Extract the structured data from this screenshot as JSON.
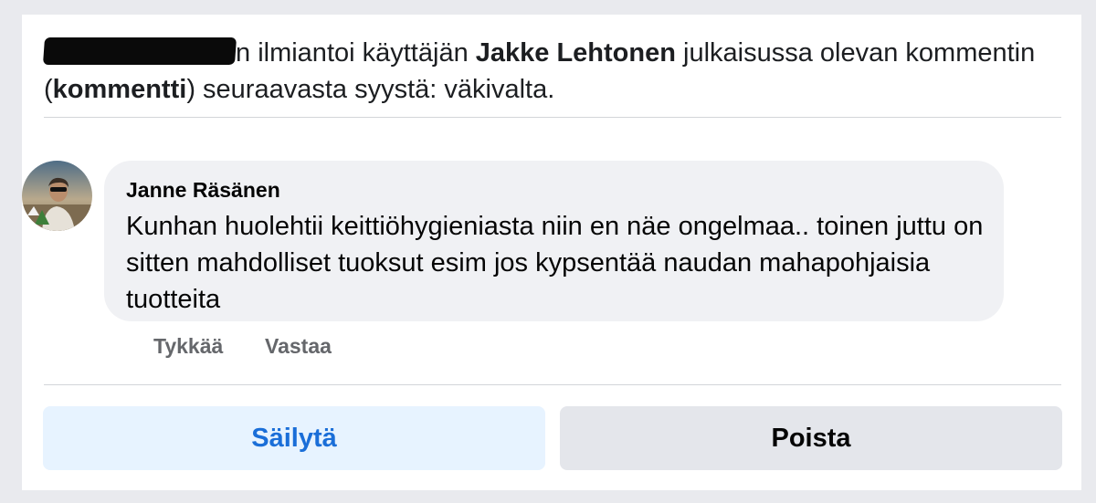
{
  "report": {
    "reporter_visible_suffix": "n",
    "text_1": " ilmiantoi käyttäjän ",
    "reported_user": "Jakke Lehtonen",
    "text_2": " julkaisussa olevan kommentin (",
    "item_type": "kommentti",
    "text_3": ") seuraavasta syystä: väkivalta."
  },
  "comment": {
    "author": "Janne Räsänen",
    "body": "Kunhan huolehtii keittiöhygieniasta niin en näe ongelmaa.. toinen juttu on sitten mahdolliset tuoksut esim jos kypsentää naudan mahapohjaisia tuotteita",
    "actions": {
      "like": "Tykkää",
      "reply": "Vastaa"
    }
  },
  "buttons": {
    "keep": "Säilytä",
    "remove": "Poista"
  },
  "colors": {
    "keep_bg": "#e7f3ff",
    "keep_text": "#1a6ed8",
    "remove_bg": "#e4e6eb",
    "secondary_text": "#65676b"
  }
}
